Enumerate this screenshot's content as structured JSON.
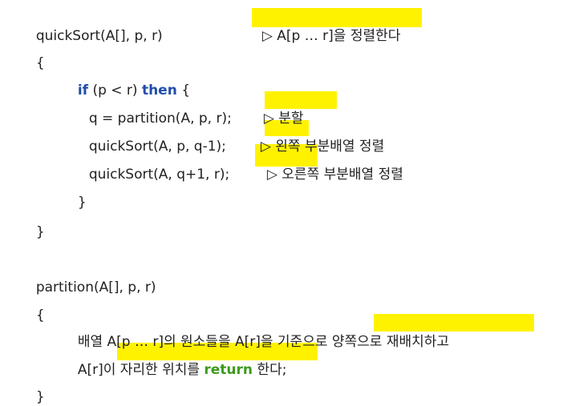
{
  "quicksort": {
    "signature": "quickSort(A[], p, r)",
    "signature_comment": "▷ A[p … r]을 정렬한다",
    "open_brace": "{",
    "if_keyword": "if",
    "if_condition": " (p < r) ",
    "then_keyword": "then",
    "if_open": " {",
    "partition_call": "q = partition(A, p, r);",
    "partition_comment": "▷ 분할",
    "left_call": "quickSort(A, p, q-1);",
    "left_comment": "▷ 왼쪽 부분배열 정렬",
    "right_call": "quickSort(A, q+1, r);",
    "right_comment": "▷ 오른쪽 부분배열 정렬",
    "inner_close": "}",
    "close_brace": "}"
  },
  "partition": {
    "signature": "partition(A[], p, r)",
    "open_brace": "{",
    "line1_a": "배열 A[p … r]의 원소들을 A[r]을 기준으로 ",
    "line1_b": "양쪽으로 재배치하고",
    "line2_a": "A[r]이 자리한 위치를 ",
    "line2_return": "return",
    "line2_b": " 한다;",
    "close_brace": "}"
  },
  "colors": {
    "highlight": "#fff200",
    "keyword_blue": "#1f4fa8",
    "keyword_green": "#3c9a1e",
    "text": "#222222"
  }
}
